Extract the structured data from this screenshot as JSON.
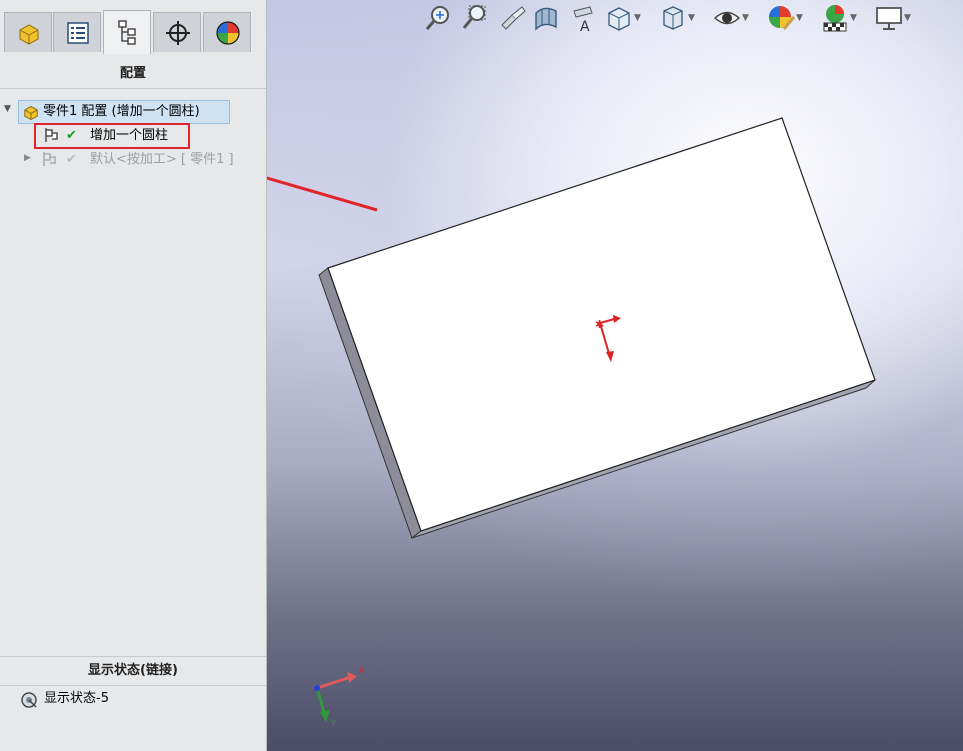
{
  "panel": {
    "tabs": [
      {
        "icon": "part-icon"
      },
      {
        "icon": "property-list-icon"
      },
      {
        "icon": "configuration-tree-icon",
        "active": true
      },
      {
        "icon": "crosshair-icon"
      },
      {
        "icon": "appearance-sphere-icon"
      }
    ],
    "title": "配置",
    "tree": {
      "root_label": "零件1 配置 (增加一个圆柱)",
      "items": [
        {
          "label": "增加一个圆柱",
          "active": true
        },
        {
          "label": "默认<按加工> [ 零件1 ]",
          "active": false
        }
      ]
    },
    "display_state": {
      "header": "显示状态(链接)",
      "item_label": "显示状态-5"
    }
  },
  "viewport": {
    "toolbar_icons": [
      "zoom-to-fit-icon",
      "zoom-to-area-icon",
      "previous-view-icon",
      "section-view-icon",
      "dynamic-annotation-icon",
      "view-orientation-icon",
      "display-style-icon",
      "hide-show-items-icon",
      "edit-appearance-icon",
      "apply-scene-icon",
      "view-settings-icon"
    ],
    "triad_labels": {
      "x": "X",
      "y": "Y"
    },
    "annotation_color": "#e0262b",
    "accent_colors": {
      "selection": "#cfe3f5",
      "highlight_border": "#e0262b"
    }
  }
}
